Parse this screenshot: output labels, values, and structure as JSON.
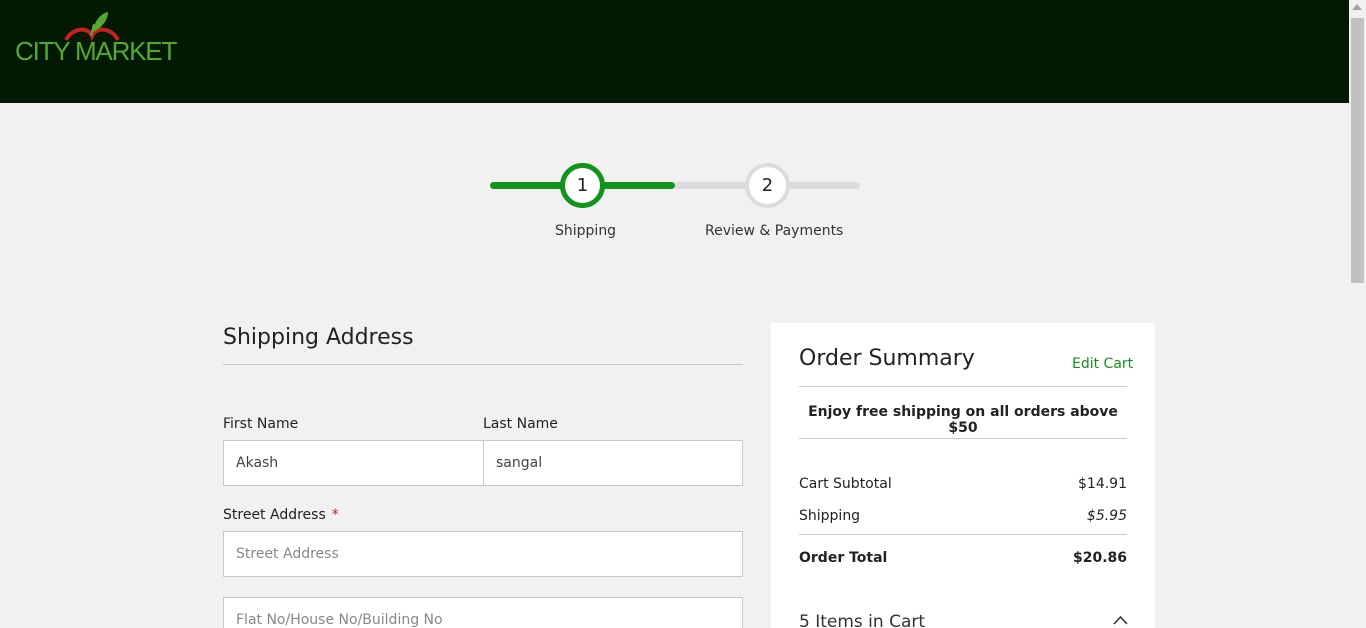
{
  "header": {
    "logo_text": "CITY MARKET",
    "brand_color": "#56a831",
    "background": "#021a03"
  },
  "stepper": {
    "active_color": "#12931b",
    "steps": [
      {
        "number": "1",
        "label": "Shipping",
        "state": "active"
      },
      {
        "number": "2",
        "label": "Review & Payments",
        "state": "pending"
      }
    ]
  },
  "shipping_form": {
    "title": "Shipping Address",
    "first_name": {
      "label": "First Name",
      "value": "Akash"
    },
    "last_name": {
      "label": "Last Name",
      "value": "sangal"
    },
    "street": {
      "label": "Street Address",
      "required_mark": "*",
      "placeholder": "Street Address"
    },
    "street2": {
      "placeholder": "Flat No/House No/Building No"
    }
  },
  "order_summary": {
    "title": "Order Summary",
    "edit_cart": "Edit Cart",
    "promo": "Enjoy free shipping on all orders above $50",
    "subtotal": {
      "label": "Cart Subtotal",
      "value": "$14.91"
    },
    "shipping": {
      "label": "Shipping",
      "value": "$5.95"
    },
    "total": {
      "label": "Order Total",
      "value": "$20.86"
    },
    "items_in_cart": "5 Items in Cart"
  }
}
